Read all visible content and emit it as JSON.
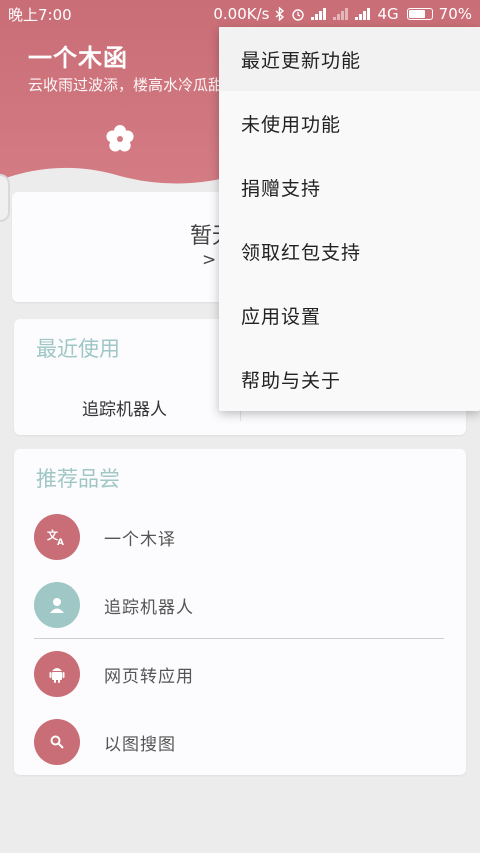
{
  "status_bar": {
    "time": "晚上7:00",
    "network_speed": "0.00K/s",
    "network_type": "4G",
    "battery": "70%",
    "icons": [
      "bluetooth-icon",
      "alarm-icon",
      "signal-icon",
      "signal-icon",
      "battery-icon"
    ]
  },
  "header": {
    "title": "一个木函",
    "subtitle": "云收雨过波添，楼高水冷瓜甜",
    "icon": "flower-icon",
    "accent_color": "#c96d76"
  },
  "notice": {
    "text": "暂无",
    "more": ">>>"
  },
  "recent": {
    "title": "最近使用",
    "items": [
      {
        "label": "追踪机器人"
      }
    ]
  },
  "recommend": {
    "title": "推荐品尝",
    "items": [
      {
        "label": "一个木译",
        "icon": "translate-icon",
        "color": "#c96d76"
      },
      {
        "label": "追踪机器人",
        "icon": "robot-icon",
        "color": "#9fc7c6"
      },
      {
        "label": "网页转应用",
        "icon": "android-icon",
        "color": "#c96d76"
      },
      {
        "label": "以图搜图",
        "icon": "search-icon",
        "color": "#c96d76"
      }
    ]
  },
  "menu": {
    "items": [
      {
        "label": "最近更新功能"
      },
      {
        "label": "未使用功能"
      },
      {
        "label": "捐赠支持"
      },
      {
        "label": "领取红包支持"
      },
      {
        "label": "应用设置"
      },
      {
        "label": "帮助与关于"
      }
    ]
  }
}
